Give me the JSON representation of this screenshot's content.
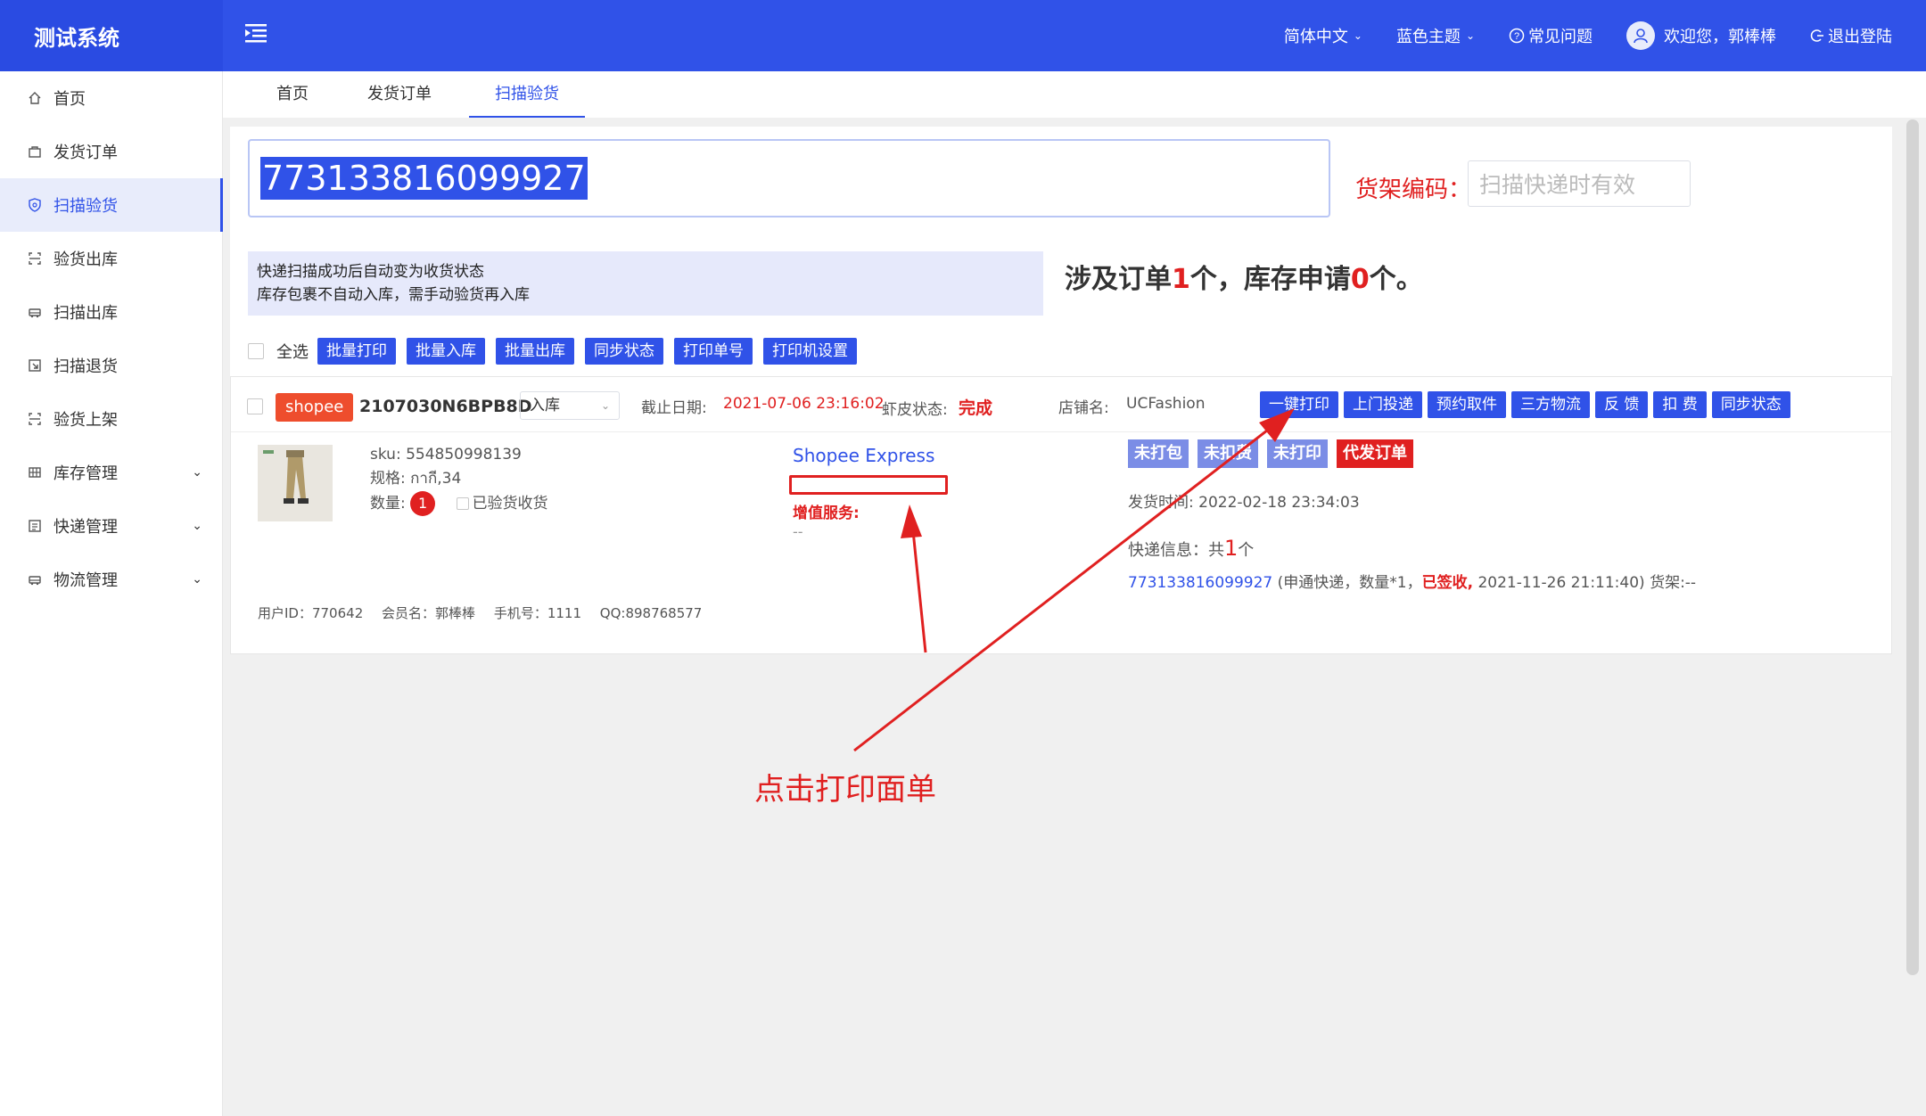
{
  "app": {
    "title": "测试系统"
  },
  "header": {
    "language": "简体中文",
    "theme": "蓝色主题",
    "faq": "常见问题",
    "welcome": "欢迎您，郭棒棒",
    "logout": "退出登陆"
  },
  "sidebar": {
    "items": [
      {
        "label": "首页",
        "icon": "home-icon"
      },
      {
        "label": "发货订单",
        "icon": "bag-icon"
      },
      {
        "label": "扫描验货",
        "icon": "shield-icon"
      },
      {
        "label": "验货出库",
        "icon": "scan-icon"
      },
      {
        "label": "扫描出库",
        "icon": "car-icon"
      },
      {
        "label": "扫描退货",
        "icon": "return-icon"
      },
      {
        "label": "验货上架",
        "icon": "scan-icon"
      },
      {
        "label": "库存管理",
        "icon": "grid-icon"
      },
      {
        "label": "快递管理",
        "icon": "list-icon"
      },
      {
        "label": "物流管理",
        "icon": "car-icon"
      }
    ],
    "active_index": 2
  },
  "tabs": [
    {
      "label": "首页"
    },
    {
      "label": "发货订单"
    },
    {
      "label": "扫描验货"
    }
  ],
  "scan": {
    "value": "773133816099927",
    "shelf_label": "货架编码：",
    "shelf_placeholder": "扫描快递时有效"
  },
  "tip": {
    "line1": "快递扫描成功后自动变为收货状态",
    "line2": "库存包裹不自动入库，需手动验货再入库"
  },
  "summary": {
    "prefix": "涉及订单",
    "orders": "1",
    "middle": "个，库存申请",
    "stock": "0",
    "suffix": "个。"
  },
  "toolbar": {
    "select_all": "全选",
    "buttons": [
      "批量打印",
      "批量入库",
      "批量出库",
      "同步状态",
      "打印单号",
      "打印机设置"
    ]
  },
  "order": {
    "platform": "shopee",
    "order_no": "2107030N6BPB8D",
    "status_select": "入库",
    "deadline_label": "截止日期:",
    "deadline": "2021-07-06 23:16:02",
    "shopee_status_label": "虾皮状态:",
    "shopee_status": "完成",
    "store_label": "店铺名:",
    "store_name": "UCFashion",
    "actions": [
      "一键打印",
      "上门投递",
      "预约取件",
      "三方物流",
      "反 馈",
      "扣 费",
      "同步状态"
    ],
    "sku_line": "sku: 554850998139",
    "spec_line": "规格: กากี,34",
    "qty_label": "数量:",
    "qty": "1",
    "verified_label": "已验货收货",
    "carrier": "Shopee Express",
    "vas_label": "增值服务:",
    "vas_value": "--",
    "tags": [
      "未打包",
      "未扣费",
      "未打印",
      "代发订单"
    ],
    "ship_time_label": "发货时间:",
    "ship_time": "2022-02-18 23:34:03",
    "express_info_prefix": "快递信息：共",
    "express_count": "1",
    "express_info_suffix": "个",
    "tracking_no": "773133816099927",
    "tracking_detail": " (申通快递，数量*1，",
    "tracking_status": "已签收,",
    "tracking_rest": " 2021-11-26 21:11:40) 货架:--",
    "user_id": "用户ID：770642",
    "member": "会员名：郭棒棒",
    "phone": "手机号：1111",
    "qq": "QQ:898768577"
  },
  "annotation": {
    "text": "点击打印面单"
  },
  "colors": {
    "primary": "#3052e8",
    "danger": "#e02020",
    "shopee": "#ee4d2d"
  }
}
